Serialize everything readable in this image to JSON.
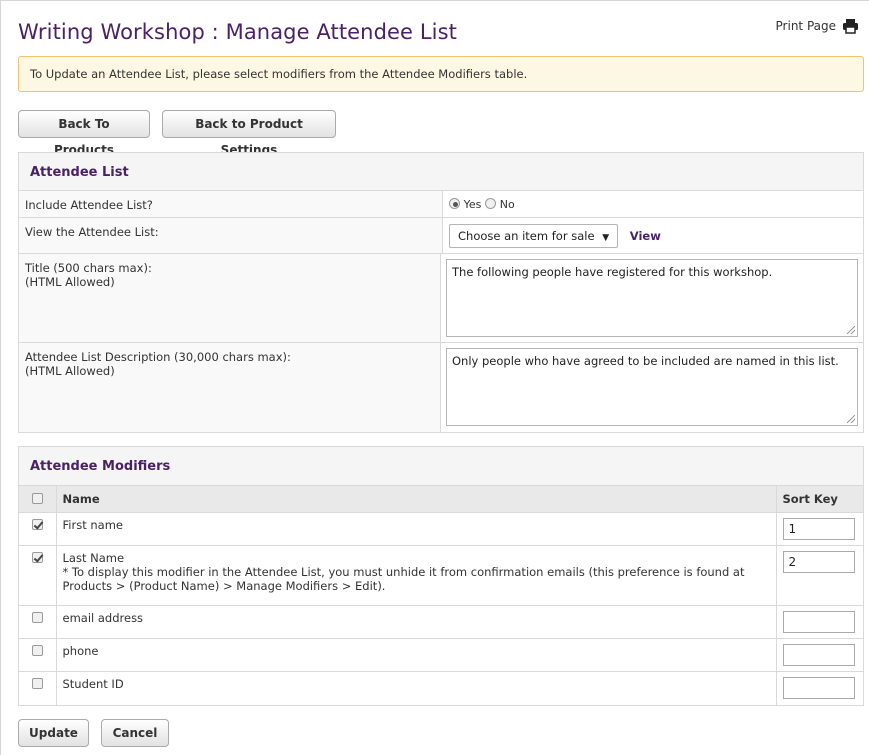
{
  "header": {
    "title": "Writing Workshop : Manage Attendee List",
    "print_label": "Print Page"
  },
  "notice": "To Update an Attendee List, please select modifiers from the Attendee Modifiers table.",
  "buttons": {
    "back_to_products": "Back To Products",
    "back_to_settings": "Back to Product Settings",
    "update": "Update",
    "cancel": "Cancel"
  },
  "attendee_list": {
    "heading": "Attendee List",
    "include_label": "Include Attendee List?",
    "include_yes": "Yes",
    "include_no": "No",
    "include_selected": "Yes",
    "view_label": "View the Attendee List:",
    "view_select_value": "Choose an item for sale",
    "view_link": "View",
    "title_label_line1": "Title (500 chars max):",
    "title_label_line2": "(HTML Allowed)",
    "title_value": "The following people have registered for this workshop.",
    "desc_label_line1": "Attendee List Description (30,000 chars max):",
    "desc_label_line2": "(HTML Allowed)",
    "desc_value": "Only people who have agreed to be included are named in this list."
  },
  "modifiers": {
    "heading": "Attendee Modifiers",
    "col_name": "Name",
    "col_sort": "Sort Key",
    "rows": [
      {
        "name": "First name",
        "checked": true,
        "sort_key": "1",
        "note": ""
      },
      {
        "name": "Last Name",
        "checked": true,
        "sort_key": "2",
        "note": "* To display this modifier in the Attendee List, you must unhide it from confirmation emails (this preference is found at Products > (Product Name) > Manage Modifiers > Edit)."
      },
      {
        "name": "email address",
        "checked": false,
        "sort_key": "",
        "note": ""
      },
      {
        "name": "phone",
        "checked": false,
        "sort_key": "",
        "note": ""
      },
      {
        "name": "Student ID",
        "checked": false,
        "sort_key": "",
        "note": ""
      }
    ]
  },
  "icons": {
    "print": "printer-icon"
  }
}
